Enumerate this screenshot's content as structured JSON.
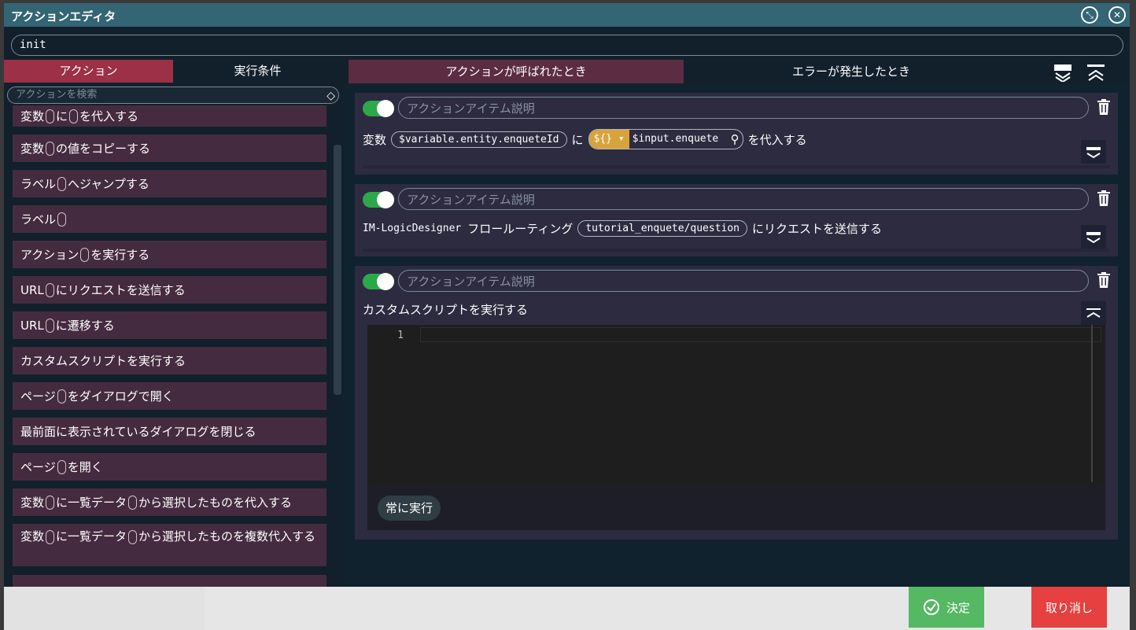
{
  "window": {
    "title": "アクションエディタ"
  },
  "name_input": {
    "value": "init"
  },
  "left_tabs": [
    {
      "label": "アクション"
    },
    {
      "label": "実行条件"
    }
  ],
  "search": {
    "placeholder": "アクションを検索"
  },
  "action_list": [
    {
      "parts": [
        "変数",
        "に",
        "を代入する"
      ]
    },
    {
      "parts": [
        "変数",
        "の値をコピーする"
      ]
    },
    {
      "parts": [
        "ラベル",
        "へジャンプする"
      ]
    },
    {
      "parts": [
        "ラベル",
        ""
      ]
    },
    {
      "parts": [
        "アクション",
        "を実行する"
      ]
    },
    {
      "parts": [
        "URL",
        "にリクエストを送信する"
      ]
    },
    {
      "parts": [
        "URL",
        "に遷移する"
      ]
    },
    {
      "parts": [
        "カスタムスクリプトを実行する"
      ]
    },
    {
      "parts": [
        "ページ",
        "をダイアログで開く"
      ]
    },
    {
      "parts": [
        "最前面に表示されているダイアログを閉じる"
      ]
    },
    {
      "parts": [
        "ページ",
        "を開く"
      ]
    },
    {
      "parts": [
        "変数",
        "に一覧データ",
        "から選択したものを代入する"
      ]
    },
    {
      "parts": [
        "変数",
        "に一覧データ",
        "から選択したものを複数代入する"
      ]
    }
  ],
  "right_tabs": [
    {
      "label": "アクションが呼ばれたとき"
    },
    {
      "label": "エラーが発生したとき"
    }
  ],
  "cards": [
    {
      "description_placeholder": "アクションアイテム説明",
      "enabled": true,
      "label_variable": "変数",
      "variable": "$variable.entity.enqueteId",
      "label_ni": "に",
      "expr_type": "${}",
      "expr_value": "$input.enquete",
      "label_assign": "を代入する"
    },
    {
      "description_placeholder": "アクションアイテム説明",
      "enabled": true,
      "label_product": "IM-LogicDesigner",
      "label_flow": "フロールーティング",
      "routing": "tutorial_enquete/question",
      "label_send": "にリクエストを送信する"
    },
    {
      "description_placeholder": "アクションアイテム説明",
      "enabled": true,
      "label_script": "カスタムスクリプトを実行する",
      "line_number": "1",
      "run_condition": "常に実行"
    }
  ],
  "footer": {
    "ok_label": "決定",
    "cancel_label": "取り消し"
  },
  "icons": {
    "restore": "restore-icon",
    "close": "close-icon",
    "eraser": "eraser-icon",
    "trash": "trash-icon",
    "chevron": "chevron-down-icon",
    "check": "check-circle-icon"
  }
}
